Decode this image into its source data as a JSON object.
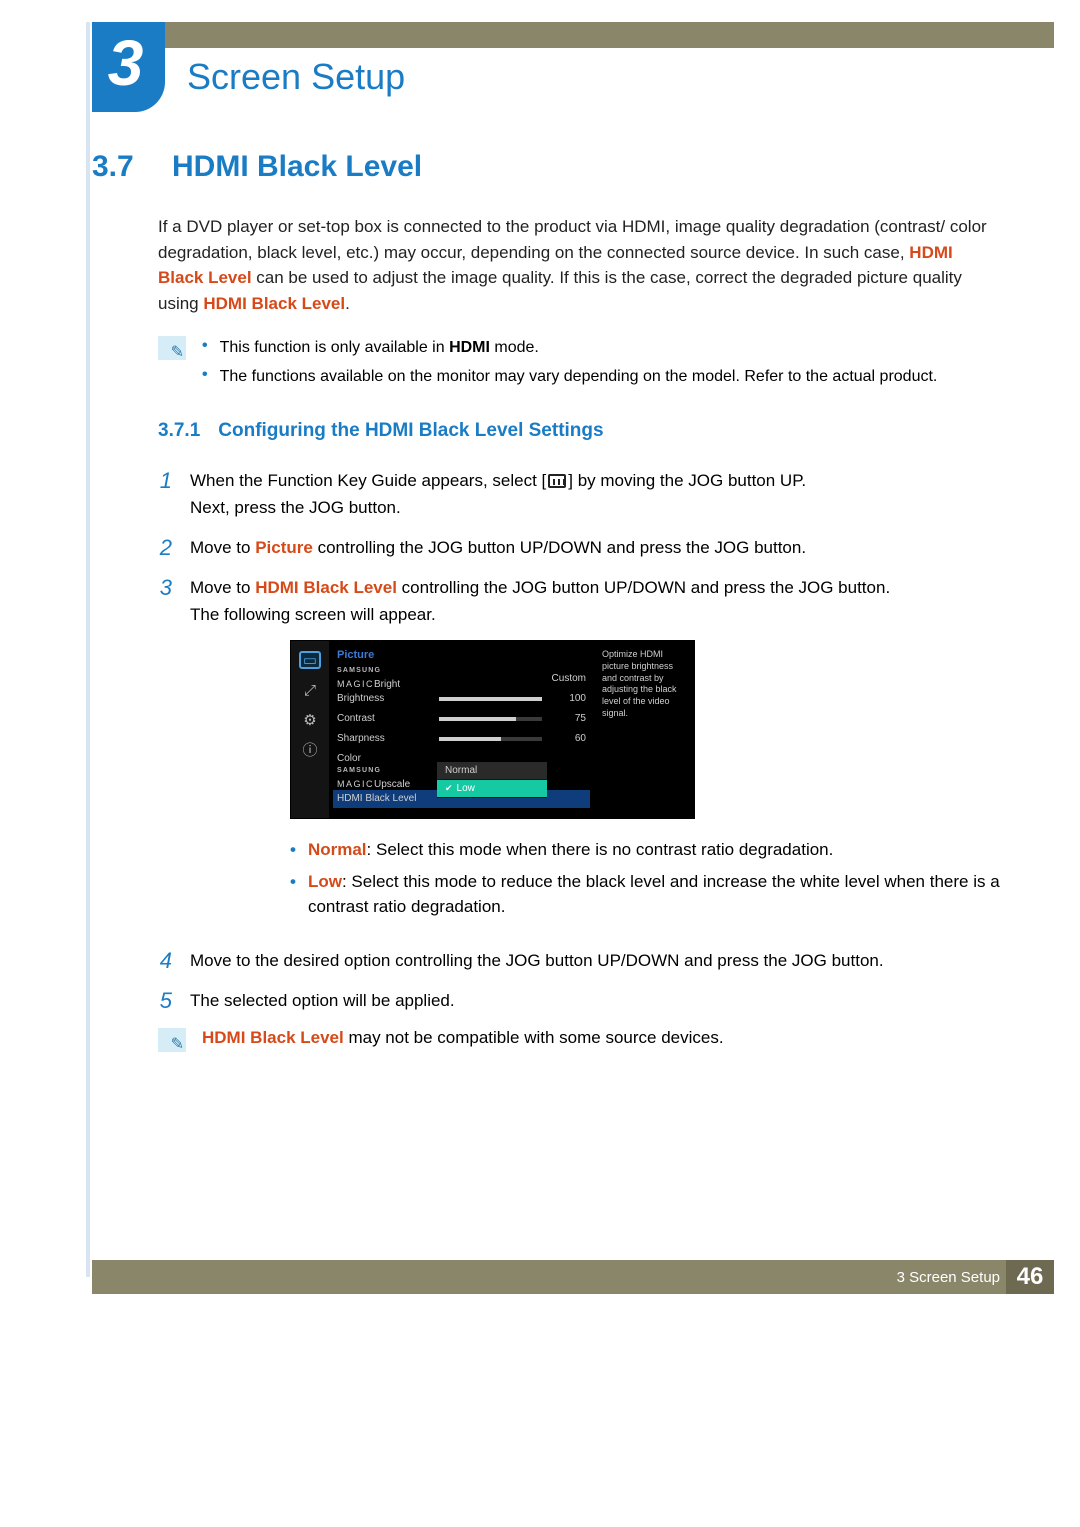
{
  "chapter": {
    "number": "3",
    "title": "Screen Setup"
  },
  "section": {
    "number": "3.7",
    "title": "HDMI Black Level"
  },
  "intro": {
    "p1_a": "If a DVD player or set-top box is connected to the product via HDMI, image quality degradation (contrast/ color degradation, black level, etc.) may occur, depending on the connected source device. In such case, ",
    "p1_hl1": "HDMI Black Level",
    "p1_b": " can be used to adjust the image quality. If this is the case, correct the degraded picture quality using ",
    "p1_hl2": "HDMI Black Level",
    "p1_c": "."
  },
  "info1": {
    "b1_a": "This function is only available in ",
    "b1_hl": "HDMI",
    "b1_b": " mode.",
    "b2": "The functions available on the monitor may vary depending on the model. Refer to the actual product."
  },
  "subsection": {
    "number": "3.7.1",
    "title": "Configuring the HDMI Black Level Settings"
  },
  "steps": {
    "s1_a": "When the Function Key Guide appears, select [",
    "s1_b": "] by moving the JOG button UP.",
    "s1_c": "Next, press the JOG button.",
    "s2_a": "Move to ",
    "s2_hl": "Picture",
    "s2_b": " controlling the JOG button UP/DOWN and press the JOG button.",
    "s3_a": "Move to ",
    "s3_hl": "HDMI Black Level",
    "s3_b": " controlling the JOG button UP/DOWN and press the JOG button.",
    "s3_c": "The following screen will appear.",
    "s4": "Move to the desired option controlling the JOG button UP/DOWN and press the JOG button.",
    "s5": "The selected option will be applied."
  },
  "osd": {
    "title": "Picture",
    "rows": {
      "magic_bright_label_top": "SAMSUNG",
      "magic_bright_label_bot": "MAGIC",
      "magic_bright_suffix": "Bright",
      "magic_bright_val": "Custom",
      "brightness_label": "Brightness",
      "brightness_val": "100",
      "contrast_label": "Contrast",
      "contrast_val": "75",
      "sharpness_label": "Sharpness",
      "sharpness_val": "60",
      "color_label": "Color",
      "magic_upscale_label_top": "SAMSUNG",
      "magic_upscale_label_bot": "MAGIC",
      "magic_upscale_suffix": "Upscale",
      "hdmi_black_label": "HDMI Black Level"
    },
    "dropdown": {
      "normal": "Normal",
      "low": "Low"
    },
    "help": "Optimize HDMI picture brightness and contrast by adjusting the black level of the video signal."
  },
  "chart_data": {
    "type": "bar",
    "title": "Picture OSD sliders",
    "categories": [
      "Brightness",
      "Contrast",
      "Sharpness"
    ],
    "values": [
      100,
      75,
      60
    ],
    "ylim": [
      0,
      100
    ],
    "xlabel": "",
    "ylabel": ""
  },
  "legend": {
    "normal_hl": "Normal",
    "normal_txt": ": Select this mode when there is no contrast ratio degradation.",
    "low_hl": "Low",
    "low_txt": ": Select this mode to reduce the black level and increase the white level when there is a contrast ratio degradation."
  },
  "info2": {
    "hl": "HDMI Black Level",
    "txt": " may not be compatible with some source devices."
  },
  "footer": {
    "chapter_ref": "3 Screen Setup",
    "page": "46"
  }
}
